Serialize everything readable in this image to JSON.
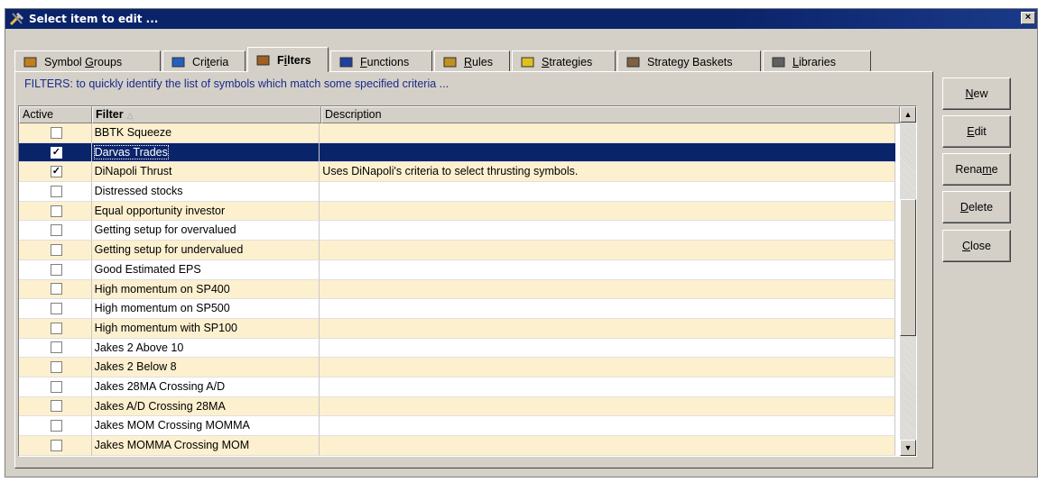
{
  "window": {
    "title": "Select item to edit ...",
    "close_label": "×"
  },
  "tabs": [
    {
      "pre": "Symbol ",
      "mn": "G",
      "post": "roups",
      "icon": "symbol-groups-icon"
    },
    {
      "pre": "Cri",
      "mn": "t",
      "post": "eria",
      "icon": "criteria-icon"
    },
    {
      "pre": "F",
      "mn": "i",
      "post": "lters",
      "icon": "filters-icon",
      "active": true
    },
    {
      "pre": "",
      "mn": "F",
      "post": "unctions",
      "icon": "functions-icon"
    },
    {
      "pre": "",
      "mn": "R",
      "post": "ules",
      "icon": "rules-icon"
    },
    {
      "pre": "",
      "mn": "S",
      "post": "trategies",
      "icon": "strategies-icon"
    },
    {
      "pre": "Strate",
      "mn": "g",
      "post": "y Baskets",
      "icon": "strategy-baskets-icon"
    },
    {
      "pre": "",
      "mn": "L",
      "post": "ibraries",
      "icon": "libraries-icon"
    }
  ],
  "info_text": "FILTERS: to quickly identify the list of symbols which match some specified criteria ...",
  "table": {
    "headers": {
      "active": "Active",
      "filter": "Filter",
      "description": "Description"
    },
    "rows": [
      {
        "active": false,
        "filter": "BBTK Squeeze",
        "description": ""
      },
      {
        "active": true,
        "filter": "Darvas Trades",
        "description": "",
        "selected": true
      },
      {
        "active": true,
        "filter": "DiNapoli Thrust",
        "description": "Uses DiNapoli's criteria to select thrusting symbols."
      },
      {
        "active": false,
        "filter": "Distressed stocks",
        "description": ""
      },
      {
        "active": false,
        "filter": "Equal opportunity investor",
        "description": ""
      },
      {
        "active": false,
        "filter": "Getting setup for overvalued",
        "description": ""
      },
      {
        "active": false,
        "filter": "Getting setup for undervalued",
        "description": ""
      },
      {
        "active": false,
        "filter": "Good Estimated EPS",
        "description": ""
      },
      {
        "active": false,
        "filter": "High momentum on SP400",
        "description": ""
      },
      {
        "active": false,
        "filter": "High momentum on SP500",
        "description": ""
      },
      {
        "active": false,
        "filter": "High momentum with SP100",
        "description": ""
      },
      {
        "active": false,
        "filter": "Jakes 2 Above 10",
        "description": ""
      },
      {
        "active": false,
        "filter": "Jakes 2 Below 8",
        "description": ""
      },
      {
        "active": false,
        "filter": "Jakes 28MA Crossing A/D",
        "description": ""
      },
      {
        "active": false,
        "filter": "Jakes A/D Crossing 28MA",
        "description": ""
      },
      {
        "active": false,
        "filter": "Jakes MOM Crossing MOMMA",
        "description": ""
      },
      {
        "active": false,
        "filter": "Jakes MOMMA Crossing MOM",
        "description": ""
      }
    ]
  },
  "buttons": [
    {
      "name": "new-button",
      "pre": "",
      "mn": "N",
      "post": "ew"
    },
    {
      "name": "edit-button",
      "pre": "",
      "mn": "E",
      "post": "dit"
    },
    {
      "name": "rename-button",
      "pre": "Rena",
      "mn": "m",
      "post": "e"
    },
    {
      "name": "delete-button",
      "pre": "",
      "mn": "D",
      "post": "elete"
    },
    {
      "name": "close-button",
      "pre": "",
      "mn": "C",
      "post": "lose"
    }
  ],
  "colors": {
    "titlebar": "#0a246a",
    "row_alt": "#fdf0cf",
    "selected_row": "#0a246a",
    "info_text": "#1a2a8a"
  },
  "scrollbar": {
    "up": "▲",
    "down": "▼"
  }
}
